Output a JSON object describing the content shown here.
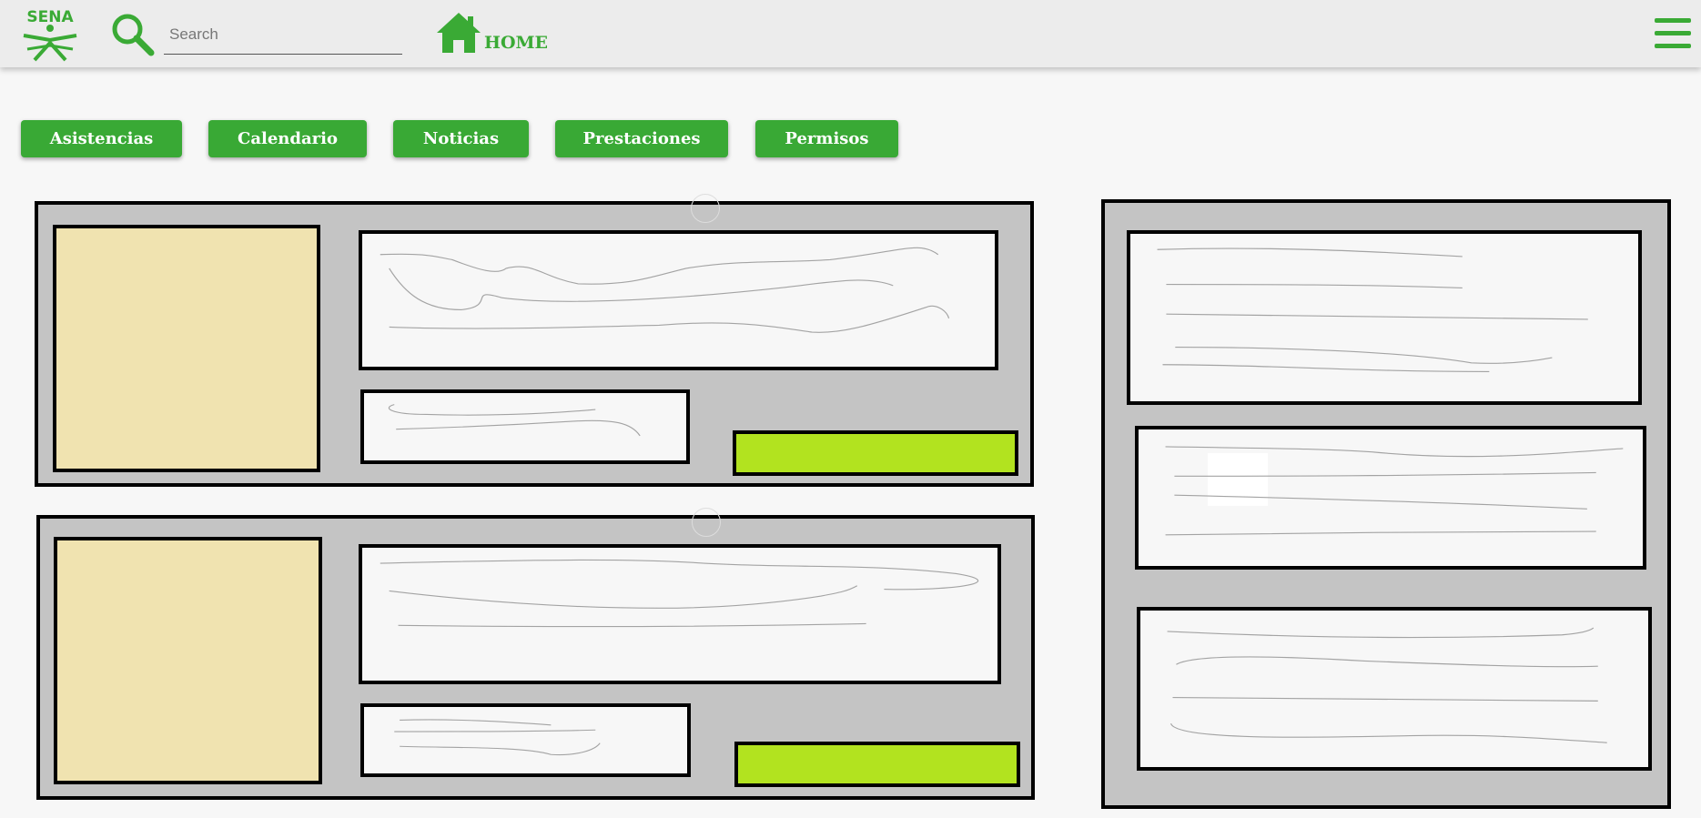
{
  "header": {
    "logo_text": "SENA",
    "search": {
      "placeholder": "Search",
      "value": ""
    },
    "home_label": "HOME"
  },
  "nav_buttons": [
    {
      "label": "Asistencias"
    },
    {
      "label": "Calendario"
    },
    {
      "label": "Noticias"
    },
    {
      "label": "Prestaciones"
    },
    {
      "label": "Permisos"
    }
  ],
  "colors": {
    "brand_green": "#39a935",
    "accent_lime": "#b2e31f",
    "card_gray": "#c4c4c4",
    "thumb_beige": "#f0e3b0"
  },
  "icons": [
    "sena-logo",
    "search-icon",
    "home-icon",
    "hamburger-menu-icon"
  ]
}
